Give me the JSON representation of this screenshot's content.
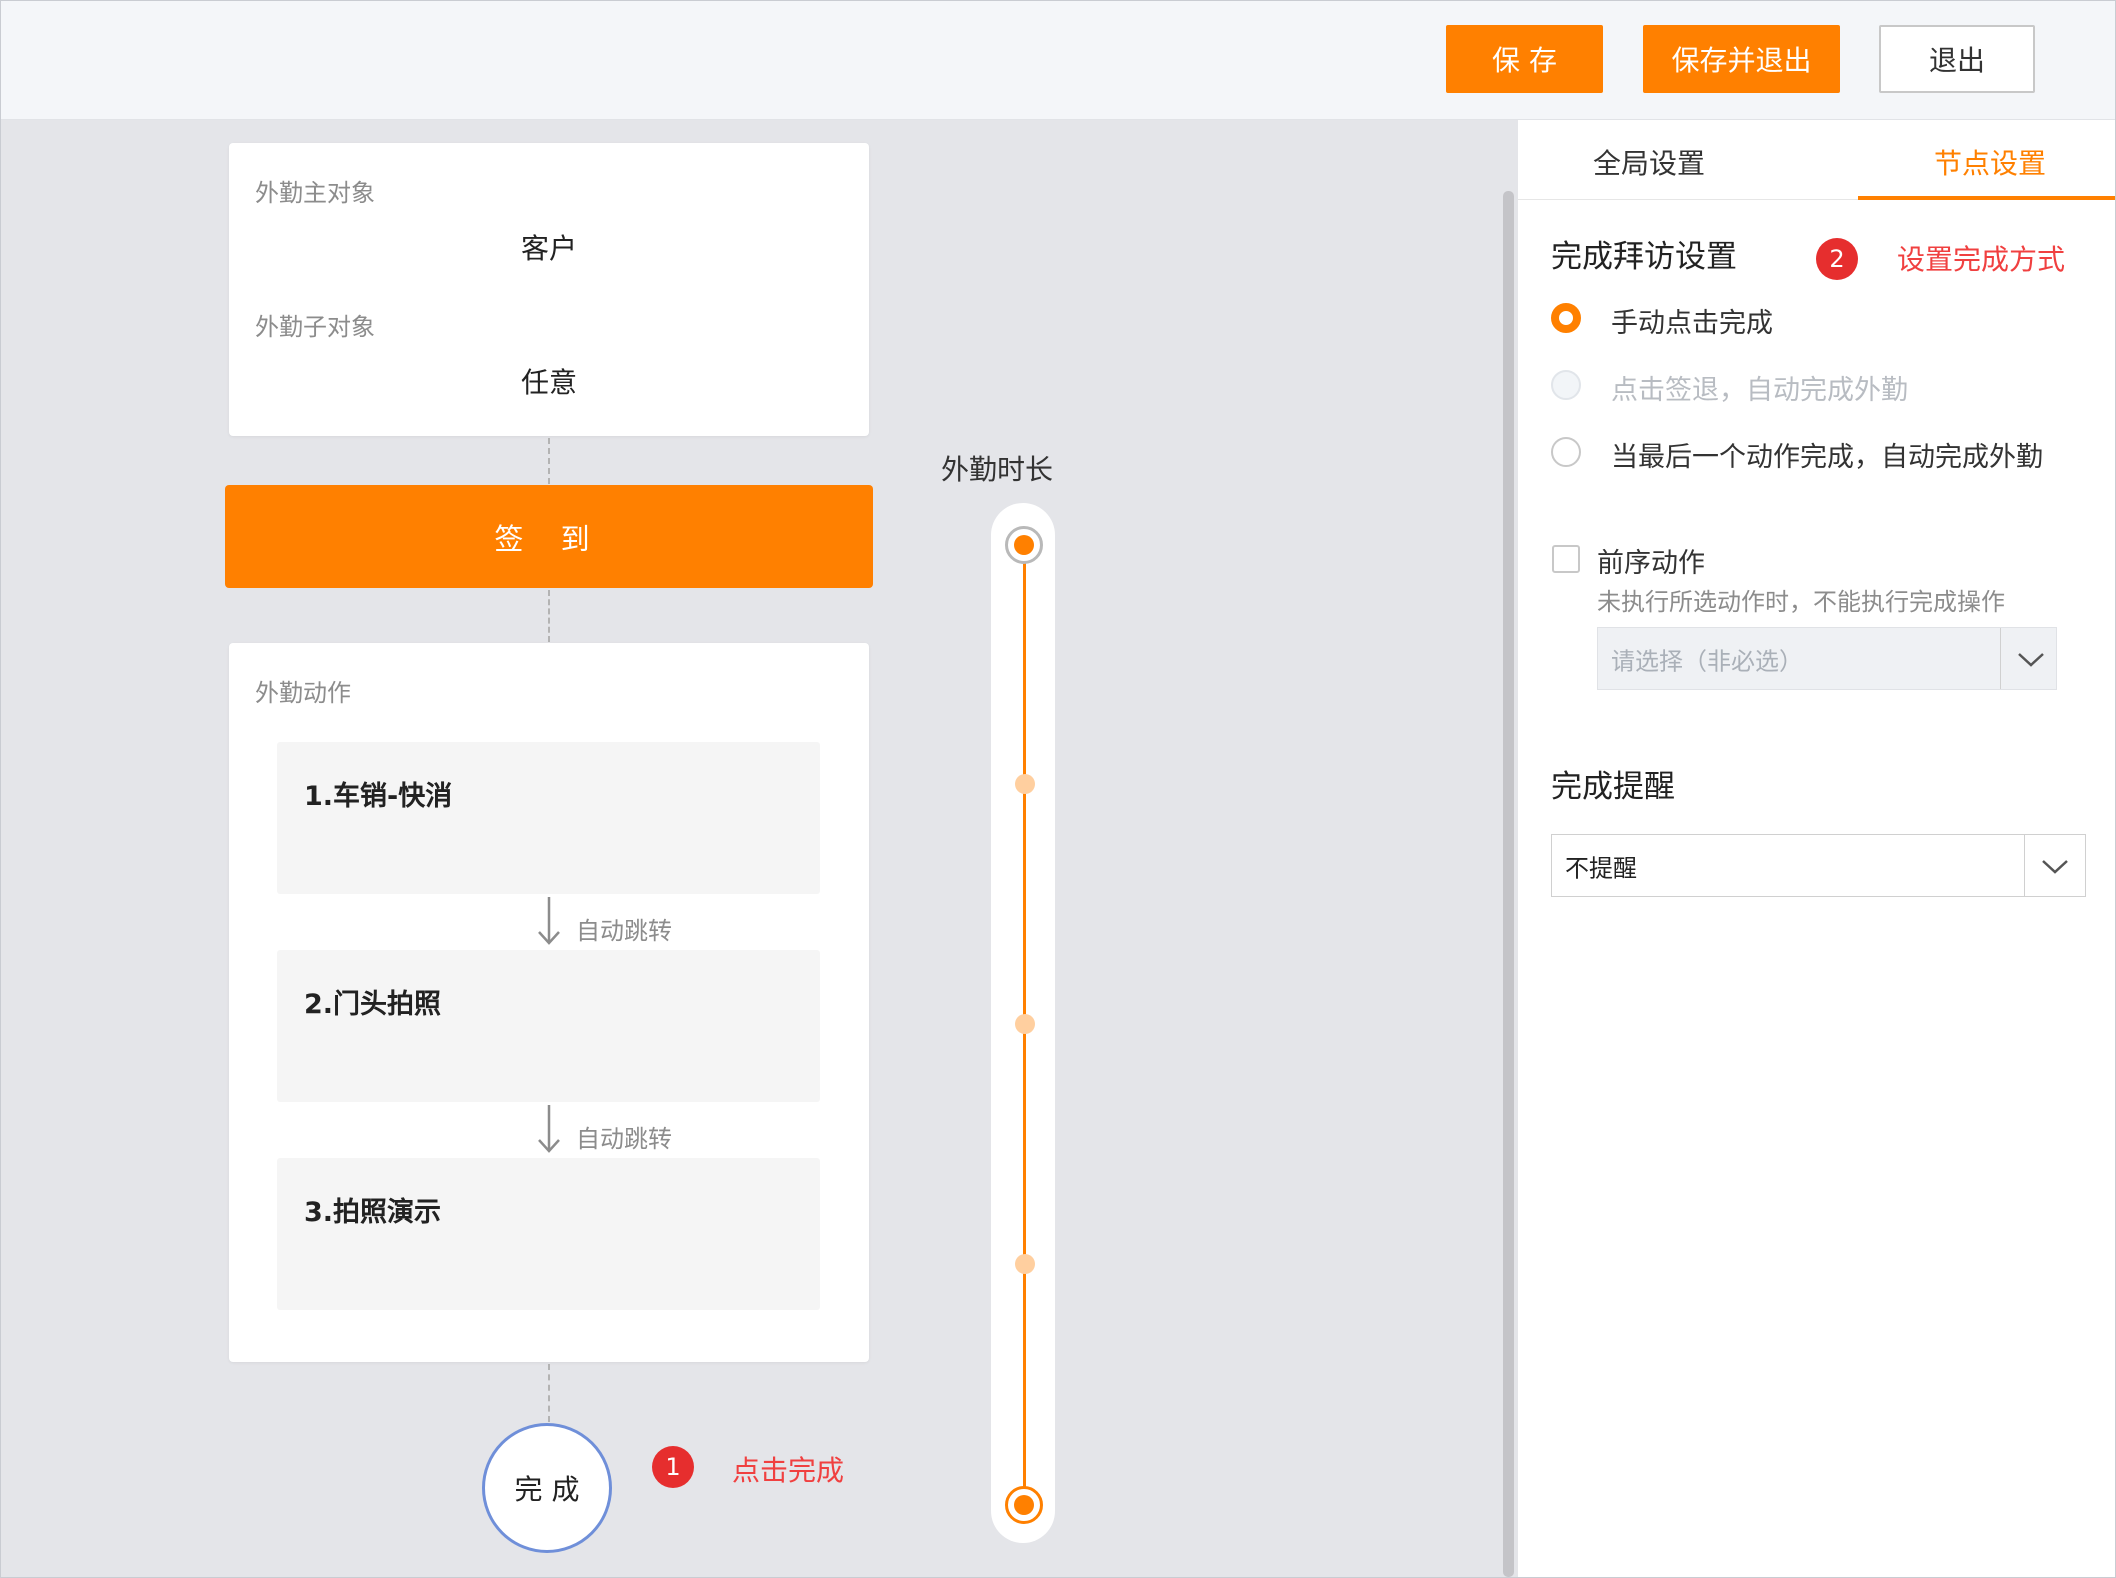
{
  "toolbar": {
    "save_label": "保 存",
    "save_exit_label": "保存并退出",
    "exit_label": "退出"
  },
  "canvas": {
    "main_object_label": "外勤主对象",
    "main_object_value": "客户",
    "sub_object_label": "外勤子对象",
    "sub_object_value": "任意",
    "checkin_label": "签 到",
    "actions_label": "外勤动作",
    "actions": [
      {
        "title": "1.车销-快消"
      },
      {
        "title": "2.门头拍照"
      },
      {
        "title": "3.拍照演示"
      }
    ],
    "auto_jump_label": "自动跳转",
    "finish_label": "完 成",
    "annotation_1": {
      "number": "1",
      "text": "点击完成"
    },
    "duration_title": "外勤时长"
  },
  "panel": {
    "tabs": [
      {
        "label": "全局设置",
        "active": false
      },
      {
        "label": "节点设置",
        "active": true
      }
    ],
    "finish_visit_title": "完成拜访设置",
    "annotation_2": {
      "number": "2",
      "text": "设置完成方式"
    },
    "radio_options": [
      {
        "label": "手动点击完成",
        "state": "selected"
      },
      {
        "label": "点击签退，自动完成外勤",
        "state": "disabled"
      },
      {
        "label": "当最后一个动作完成，自动完成外勤",
        "state": "unselected"
      }
    ],
    "prev_action_label": "前序动作",
    "prev_action_hint": "未执行所选动作时，不能执行完成操作",
    "prev_action_placeholder": "请选择（非必选）",
    "reminder_title": "完成提醒",
    "reminder_value": "不提醒"
  },
  "colors": {
    "accent": "#ff8000",
    "annotation_red": "#e62e2e",
    "finish_ring": "#6f8fd9"
  }
}
